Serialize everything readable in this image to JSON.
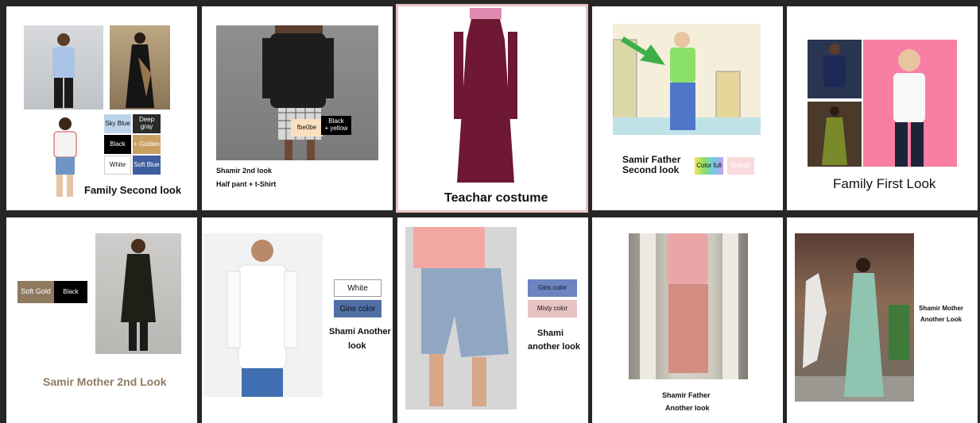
{
  "cards": {
    "family_second": {
      "title": "Family Second look",
      "swatches": [
        "Sky Blue",
        "Deep gray",
        "Black",
        "+ Golden",
        "White",
        "Soft Blue"
      ]
    },
    "shamir_second": {
      "line1": "Shamir 2nd look",
      "line2": "Half pant + t-Shirt",
      "tag_fbe0be": "fbe0be",
      "tag_black_yellow": "Black\n+ yellow"
    },
    "teacher": {
      "title": "Teachar costume"
    },
    "samir_father_second": {
      "title_line1": "Samir Father",
      "title_line2": "Second look",
      "swatch_colorful": "Color full",
      "swatch_pink": "fadadd"
    },
    "family_first": {
      "title": "Family First Look"
    },
    "samir_mother_second": {
      "title": "Samir Mother 2nd Look",
      "swatches": [
        "Soft Gold",
        "Black"
      ]
    },
    "shami_another": {
      "swatches": [
        "White",
        "Gins color"
      ],
      "title_line1": "Shami Another",
      "title_line2": "look"
    },
    "shami_another2": {
      "swatches": [
        "Gins color",
        "Misty color"
      ],
      "title_line1": "Shami",
      "title_line2": "another look"
    },
    "shamir_father_another": {
      "title_line1": "Shamir Father",
      "title_line2": "Another look"
    },
    "shamir_mother_another": {
      "title_line1": "Shamir Mother",
      "title_line2": "Another Look"
    }
  },
  "colors": {
    "background": "#262626",
    "sky_blue": "#bcd3ea",
    "deep_gray": "#2b2b2b",
    "black": "#000000",
    "golden": "#c9a063",
    "white": "#ffffff",
    "soft_blue": "#3f5ea0",
    "fbe0be": "#fbe0be",
    "soft_gold": "#8f7a60",
    "gins": "#4f6fa5",
    "misty": "#e8c3c3",
    "fadadd": "#fadadd",
    "mother_title": "#8f7a60"
  }
}
